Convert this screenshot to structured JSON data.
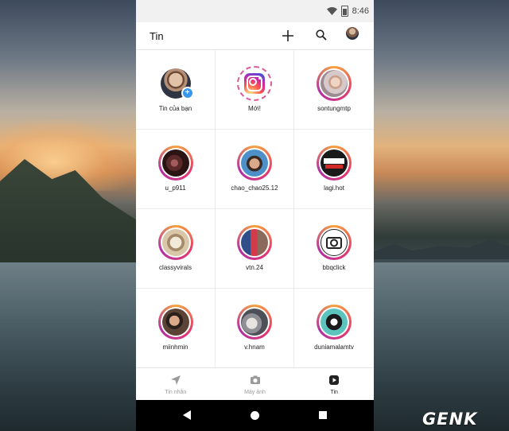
{
  "status_bar": {
    "time": "8:46"
  },
  "header": {
    "title": "Tin"
  },
  "stories": [
    {
      "label": "Tin của bạn",
      "type": "own"
    },
    {
      "label": "Mới!",
      "type": "new"
    },
    {
      "label": "sontungmtp",
      "type": "story"
    },
    {
      "label": "u_p911",
      "type": "story"
    },
    {
      "label": "chao_chao25.12",
      "type": "story"
    },
    {
      "label": "lagi.hot",
      "type": "story"
    },
    {
      "label": "classyvirals",
      "type": "story"
    },
    {
      "label": "vtn.24",
      "type": "story"
    },
    {
      "label": "bbqclick",
      "type": "story"
    },
    {
      "label": "miinhmin",
      "type": "story"
    },
    {
      "label": "v.hnam",
      "type": "story"
    },
    {
      "label": "duniamalamtv",
      "type": "story"
    }
  ],
  "tabs": [
    {
      "label": "Tin nhắn",
      "icon": "send-icon"
    },
    {
      "label": "Máy ảnh",
      "icon": "camera-icon"
    },
    {
      "label": "Tin",
      "icon": "play-icon",
      "active": true
    }
  ],
  "watermark": "GENK",
  "colors": {
    "story_ring_start": "#f7a23b",
    "story_ring_mid": "#e53a6b",
    "story_ring_end": "#b12fa5",
    "badge": "#3897f0"
  }
}
